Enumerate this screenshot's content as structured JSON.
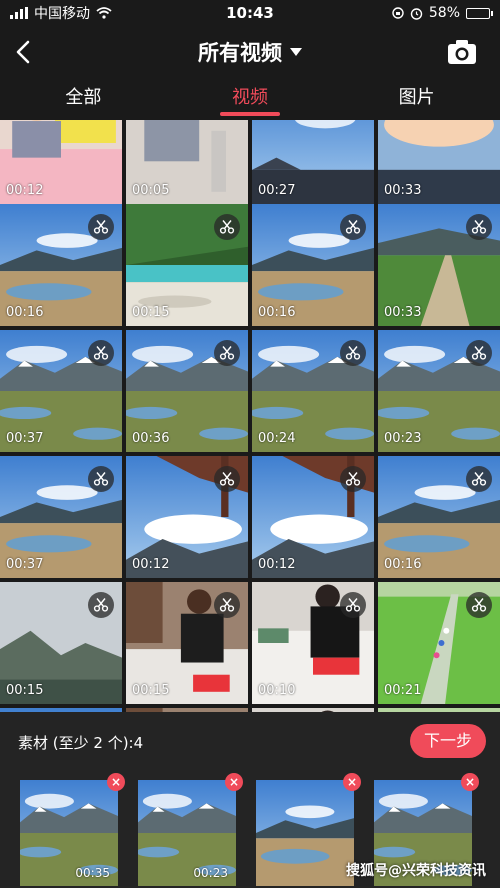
{
  "status_bar": {
    "carrier": "中国移动",
    "time": "10:43",
    "battery": "58%",
    "battery_level": 0.58
  },
  "header": {
    "title": "所有视频"
  },
  "tabs": [
    {
      "label": "全部",
      "active": false
    },
    {
      "label": "视频",
      "active": true
    },
    {
      "label": "图片",
      "active": false
    }
  ],
  "grid": [
    {
      "duration": "00:12",
      "scene": "baby",
      "scissor": false
    },
    {
      "duration": "00:05",
      "scene": "baby-floor",
      "scissor": false
    },
    {
      "duration": "00:27",
      "scene": "sky-town",
      "scissor": false
    },
    {
      "duration": "00:33",
      "scene": "dusk",
      "scissor": false
    },
    {
      "duration": "00:16",
      "scene": "lake",
      "scissor": true
    },
    {
      "duration": "00:15",
      "scene": "terraces",
      "scissor": true
    },
    {
      "duration": "00:16",
      "scene": "lake",
      "scissor": true
    },
    {
      "duration": "00:33",
      "scene": "path",
      "scissor": true
    },
    {
      "duration": "00:37",
      "scene": "valley",
      "scissor": true
    },
    {
      "duration": "00:36",
      "scene": "valley",
      "scissor": true
    },
    {
      "duration": "00:24",
      "scene": "valley",
      "scissor": true
    },
    {
      "duration": "00:23",
      "scene": "valley",
      "scissor": true
    },
    {
      "duration": "00:37",
      "scene": "lake",
      "scissor": true
    },
    {
      "duration": "00:12",
      "scene": "tree-sky",
      "scissor": true
    },
    {
      "duration": "00:12",
      "scene": "tree-sky",
      "scissor": true
    },
    {
      "duration": "00:16",
      "scene": "lake",
      "scissor": true
    },
    {
      "duration": "00:15",
      "scene": "fog",
      "scissor": true
    },
    {
      "duration": "00:15",
      "scene": "boy-room",
      "scissor": true
    },
    {
      "duration": "00:10",
      "scene": "boy-bed",
      "scissor": true
    },
    {
      "duration": "00:21",
      "scene": "rice",
      "scissor": true
    },
    {
      "duration": "",
      "scene": "valley",
      "scissor": false
    },
    {
      "duration": "",
      "scene": "boy-room",
      "scissor": false
    },
    {
      "duration": "",
      "scene": "boy-bed",
      "scissor": false
    },
    {
      "duration": "",
      "scene": "rice",
      "scissor": false
    }
  ],
  "bottom": {
    "material_label": "素材 (至少 2 个):4",
    "next_label": "下一步",
    "selected": [
      {
        "duration": "00:35",
        "scene": "valley"
      },
      {
        "duration": "00:23",
        "scene": "valley"
      },
      {
        "duration": "",
        "scene": "lake"
      },
      {
        "duration": "",
        "scene": "valley"
      }
    ],
    "remove_label": "×",
    "watermark": "搜狐号@兴荣科技资讯"
  },
  "colors": {
    "accent": "#f04b5a",
    "background": "#1a1a1a",
    "panel": "#242424"
  }
}
